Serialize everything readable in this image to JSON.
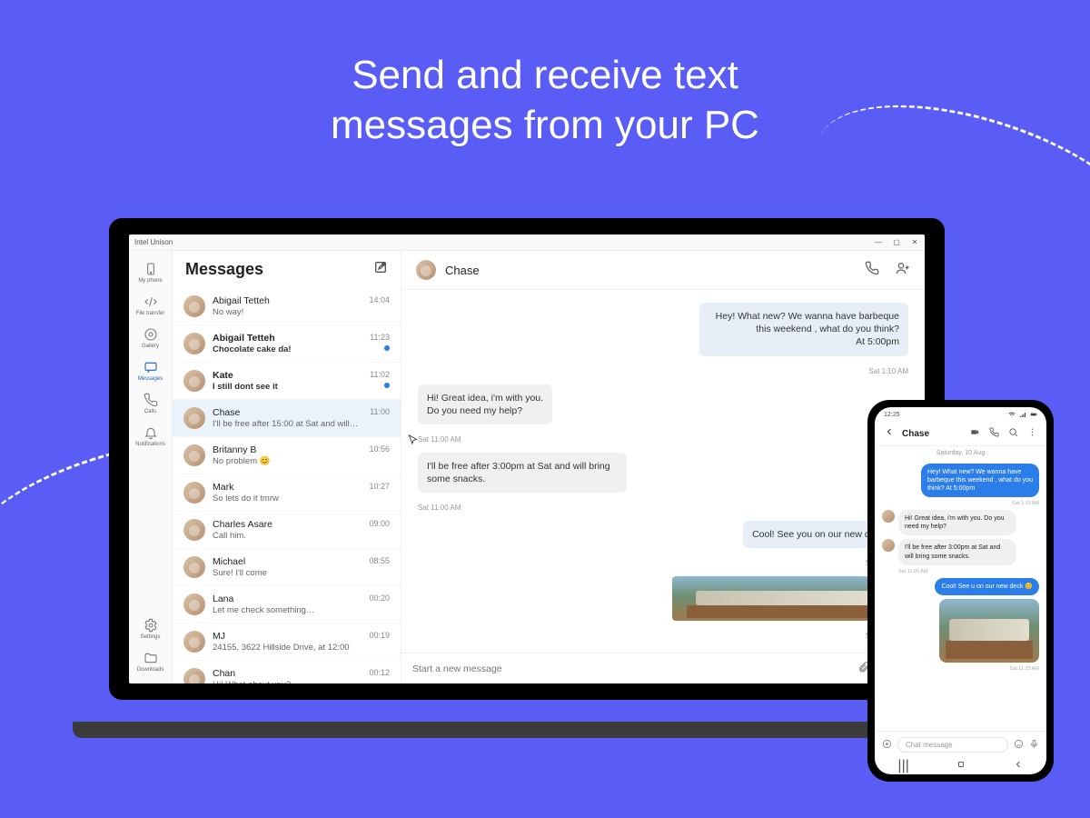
{
  "promo_title": "Send and receive text\nmessages from your PC",
  "window": {
    "title": "Intel Unison"
  },
  "rail": {
    "items": [
      {
        "id": "my-phone",
        "label": "My phone"
      },
      {
        "id": "file-transfer",
        "label": "File transfer"
      },
      {
        "id": "gallery",
        "label": "Gallery"
      },
      {
        "id": "messages",
        "label": "Messages",
        "active": true
      },
      {
        "id": "calls",
        "label": "Calls"
      },
      {
        "id": "notifications",
        "label": "Notifications"
      }
    ],
    "bottom": [
      {
        "id": "settings",
        "label": "Settings"
      },
      {
        "id": "downloads",
        "label": "Downloads"
      }
    ]
  },
  "messages_title": "Messages",
  "conversations": [
    {
      "name": "Abigail Tetteh",
      "preview": "No way!",
      "time": "14:04",
      "unread": false
    },
    {
      "name": "Abigail Tetteh",
      "preview": "Chocolate cake da!",
      "time": "11:23",
      "unread": true
    },
    {
      "name": "Kate",
      "preview": "I still dont see it",
      "time": "11:02",
      "unread": true
    },
    {
      "name": "Chase",
      "preview": "I'll be free after 15:00 at Sat and will…",
      "time": "11:00",
      "selected": true
    },
    {
      "name": "Britanny B",
      "preview": "No problem 😊",
      "time": "10:56"
    },
    {
      "name": "Mark",
      "preview": "So lets do it tmrw",
      "time": "10:27"
    },
    {
      "name": "Charles Asare",
      "preview": "Call him.",
      "time": "09:00"
    },
    {
      "name": "Michael",
      "preview": "Sure! I'll come",
      "time": "08:55"
    },
    {
      "name": "Lana",
      "preview": "Let me check something…",
      "time": "00:20"
    },
    {
      "name": "MJ",
      "preview": "24155, 3622 Hillside Drive, at 12:00",
      "time": "00:19"
    },
    {
      "name": "Chan",
      "preview": "Hi! What about you?",
      "time": "00:12"
    }
  ],
  "chat": {
    "contact": "Chase",
    "messages": [
      {
        "dir": "out",
        "text": "Hey! What new? We wanna have barbeque this weekend , what do you think?\nAt 5:00pm",
        "ts": "Sat 1:10 AM"
      },
      {
        "dir": "in",
        "text": "Hi! Great idea, i'm with you.\nDo you need my help?",
        "ts": "Sat 11:00 AM"
      },
      {
        "dir": "in",
        "text": "I'll be free after 3:00pm at Sat and will bring some snacks.",
        "ts": "Sat 11:00 AM"
      },
      {
        "dir": "out",
        "text": "Cool! See you on our new deck 😊",
        "ts": "Sat 11:22 AM"
      },
      {
        "dir": "out",
        "image": true,
        "ts": "Sat 11:25 AM"
      }
    ],
    "composer_placeholder": "Start a new message"
  },
  "phone": {
    "status_time": "12:25",
    "contact": "Chase",
    "date": "Saturday, 10 Aug",
    "messages": [
      {
        "dir": "out",
        "text": "Hey! What new? We wanna have barbeque this weekend , what do you think? At 5:00pm",
        "ts": "Sat 1:10 AM"
      },
      {
        "dir": "in",
        "text": "Hi! Great idea, i'm with you. Do you need my help?",
        "ts": ""
      },
      {
        "dir": "in",
        "text": "I'll be free after 3:00pm at Sat and will bring some snacks.",
        "ts": "Sat 11:00 AM"
      },
      {
        "dir": "out",
        "text": "Cool! See u on our new deck 😊",
        "ts": ""
      },
      {
        "dir": "out",
        "image": true,
        "ts": "Sat 11:25 AM"
      }
    ],
    "composer_placeholder": "Chat message"
  }
}
